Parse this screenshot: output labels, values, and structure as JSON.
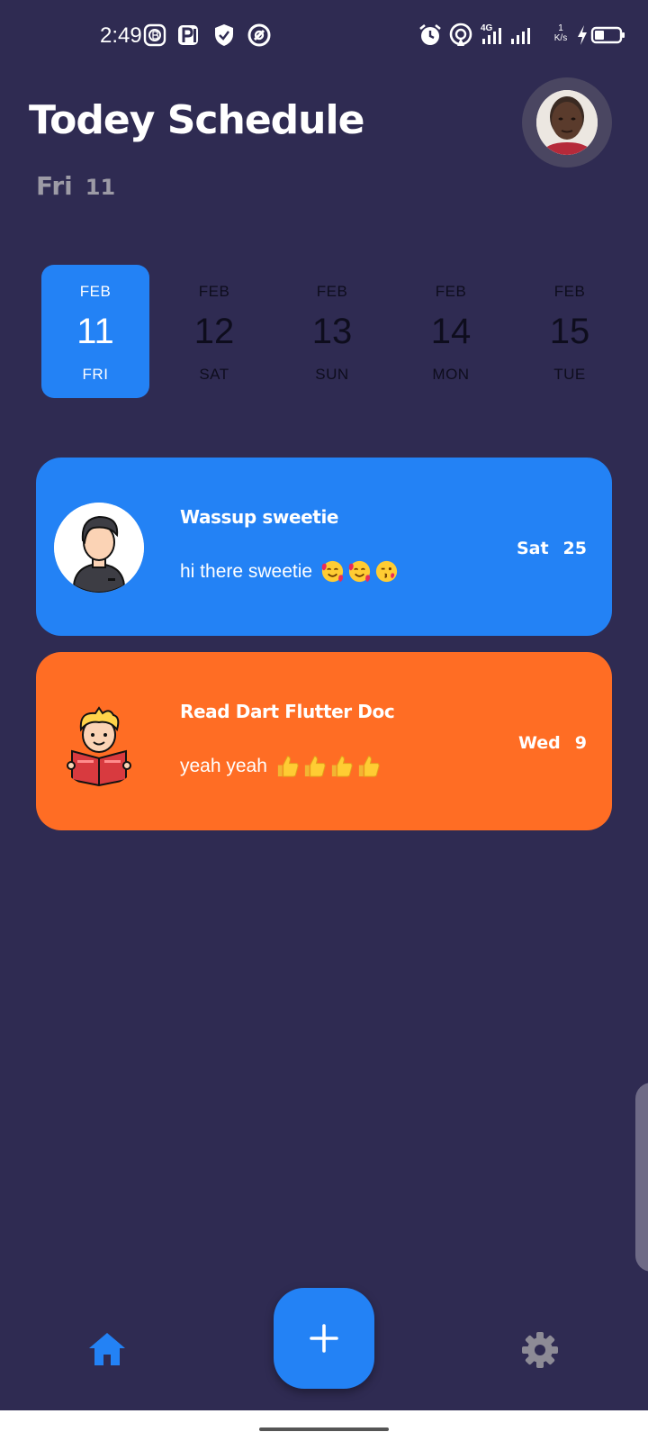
{
  "status_bar": {
    "time": "2:49",
    "network_type": "4G",
    "speed_value": "1",
    "speed_unit": "K/s",
    "icons": [
      "b-app-icon",
      "parking-app-icon",
      "shield-icon",
      "hotspot-ring-icon",
      "alarm-icon",
      "hotspot-icon",
      "signal-4g-icon",
      "signal-icon",
      "charging-bolt-icon",
      "battery-icon"
    ]
  },
  "header": {
    "title": "Todey Schedule",
    "day_name": "Fri",
    "day_number": "11"
  },
  "date_strip": {
    "selected_index": 0,
    "dates": [
      {
        "month": "FEB",
        "day": "11",
        "weekday": "FRI"
      },
      {
        "month": "FEB",
        "day": "12",
        "weekday": "SAT"
      },
      {
        "month": "FEB",
        "day": "13",
        "weekday": "SUN"
      },
      {
        "month": "FEB",
        "day": "14",
        "weekday": "MON"
      },
      {
        "month": "FEB",
        "day": "15",
        "weekday": "TUE"
      }
    ]
  },
  "tasks": [
    {
      "title": "Wassup sweetie",
      "description": "hi there sweetie",
      "emojis": [
        "smiling-face-with-hearts",
        "smiling-face-with-hearts",
        "face-blowing-kiss"
      ],
      "day": "Sat",
      "date": "25",
      "color": "#2382f5",
      "icon": "man-avatar-icon"
    },
    {
      "title": "Read Dart Flutter Doc",
      "description": "yeah yeah",
      "emojis": [
        "thumbs-up",
        "thumbs-up",
        "thumbs-up",
        "thumbs-up"
      ],
      "day": "Wed",
      "date": "9",
      "color": "#ff6d24",
      "icon": "reading-boy-icon"
    }
  ],
  "bottom_nav": {
    "home_icon": "home-icon",
    "add_icon": "plus-icon",
    "settings_icon": "gear-icon"
  },
  "colors": {
    "background": "#2f2b52",
    "accent": "#2382f5",
    "orange": "#ff6d24",
    "muted": "#9d9ba6"
  }
}
